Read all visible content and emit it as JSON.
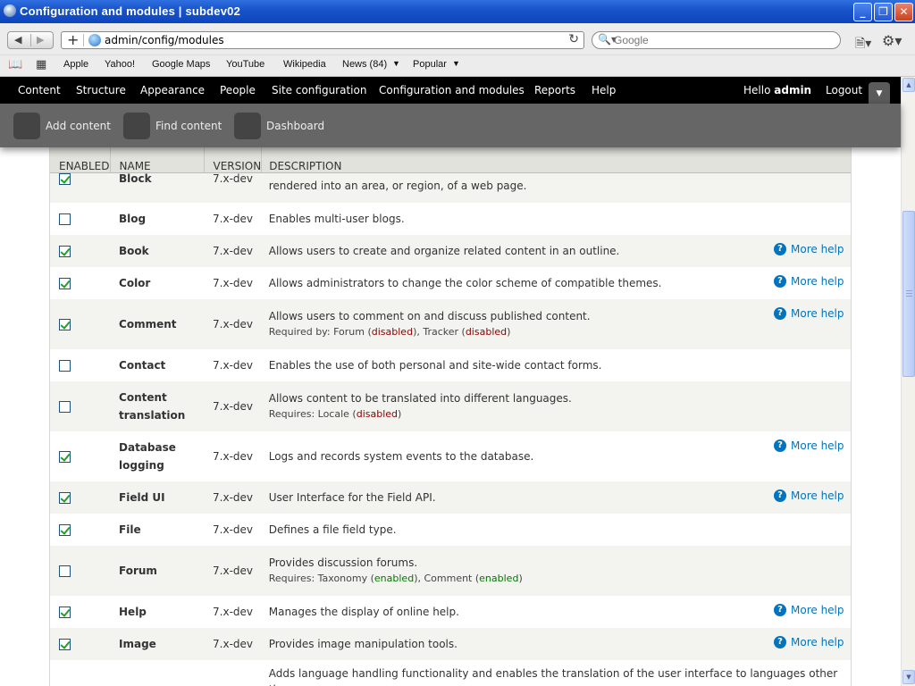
{
  "window": {
    "title": "Configuration and modules | subdev02"
  },
  "nav": {
    "url": "admin/config/modules",
    "search_placeholder": "Google"
  },
  "bookmarks": [
    "Apple",
    "Yahoo!",
    "Google Maps",
    "YouTube",
    "Wikipedia",
    "News (84)",
    "Popular"
  ],
  "toolbar": {
    "menu": [
      "Content",
      "Structure",
      "Appearance",
      "People",
      "Site configuration",
      "Configuration and modules",
      "Reports",
      "Help"
    ],
    "hello": "Hello",
    "user": "admin",
    "logout": "Logout"
  },
  "shortcuts": [
    "Add content",
    "Find content",
    "Dashboard"
  ],
  "table": {
    "headers": {
      "enabled": "ENABLED",
      "name": "NAME",
      "version": "VERSION",
      "description": "DESCRIPTION"
    },
    "help_label": "More help",
    "first_row_partial": {
      "name": "Block",
      "version": "7.x-dev",
      "description": "rendered into an area, or region, of a web page."
    },
    "rows": [
      {
        "name": "Blog",
        "version": "7.x-dev",
        "description": "Enables multi-user blogs.",
        "enabled": false
      },
      {
        "name": "Book",
        "version": "7.x-dev",
        "description": "Allows users to create and organize related content in an outline.",
        "enabled": true,
        "help": true
      },
      {
        "name": "Color",
        "version": "7.x-dev",
        "description": "Allows administrators to change the color scheme of compatible themes.",
        "enabled": true,
        "help": true
      },
      {
        "name": "Comment",
        "version": "7.x-dev",
        "description": "Allows users to comment on and discuss published content.",
        "enabled": true,
        "help": true,
        "sub_prefix": "Required by: Forum (",
        "sub_s1": "disabled",
        "sub_mid": "), Tracker (",
        "sub_s2": "disabled",
        "sub_suffix": ")"
      },
      {
        "name": "Contact",
        "version": "7.x-dev",
        "description": "Enables the use of both personal and site-wide contact forms.",
        "enabled": false
      },
      {
        "name": "Content translation",
        "version": "7.x-dev",
        "description": "Allows content to be translated into different languages.",
        "enabled": false,
        "sub_prefix": "Requires: Locale (",
        "sub_s1": "disabled",
        "sub_suffix": ")"
      },
      {
        "name": "Database logging",
        "version": "7.x-dev",
        "description": "Logs and records system events to the database.",
        "enabled": true,
        "help": true
      },
      {
        "name": "Field UI",
        "version": "7.x-dev",
        "description": "User Interface for the Field API.",
        "enabled": true,
        "help": true
      },
      {
        "name": "File",
        "version": "7.x-dev",
        "description": "Defines a file field type.",
        "enabled": true
      },
      {
        "name": "Forum",
        "version": "7.x-dev",
        "description": "Provides discussion forums.",
        "enabled": false,
        "sub_prefix": "Requires: Taxonomy (",
        "sub_s1": "enabled",
        "sub_mid": "), Comment (",
        "sub_s2": "enabled",
        "sub_suffix": ")"
      },
      {
        "name": "Help",
        "version": "7.x-dev",
        "description": "Manages the display of online help.",
        "enabled": true,
        "help": true
      },
      {
        "name": "Image",
        "version": "7.x-dev",
        "description": "Provides image manipulation tools.",
        "enabled": true,
        "help": true
      },
      {
        "name": "",
        "version": "",
        "description": "Adds language handling functionality and enables the translation of the user interface to languages other than",
        "enabled": null
      }
    ]
  }
}
